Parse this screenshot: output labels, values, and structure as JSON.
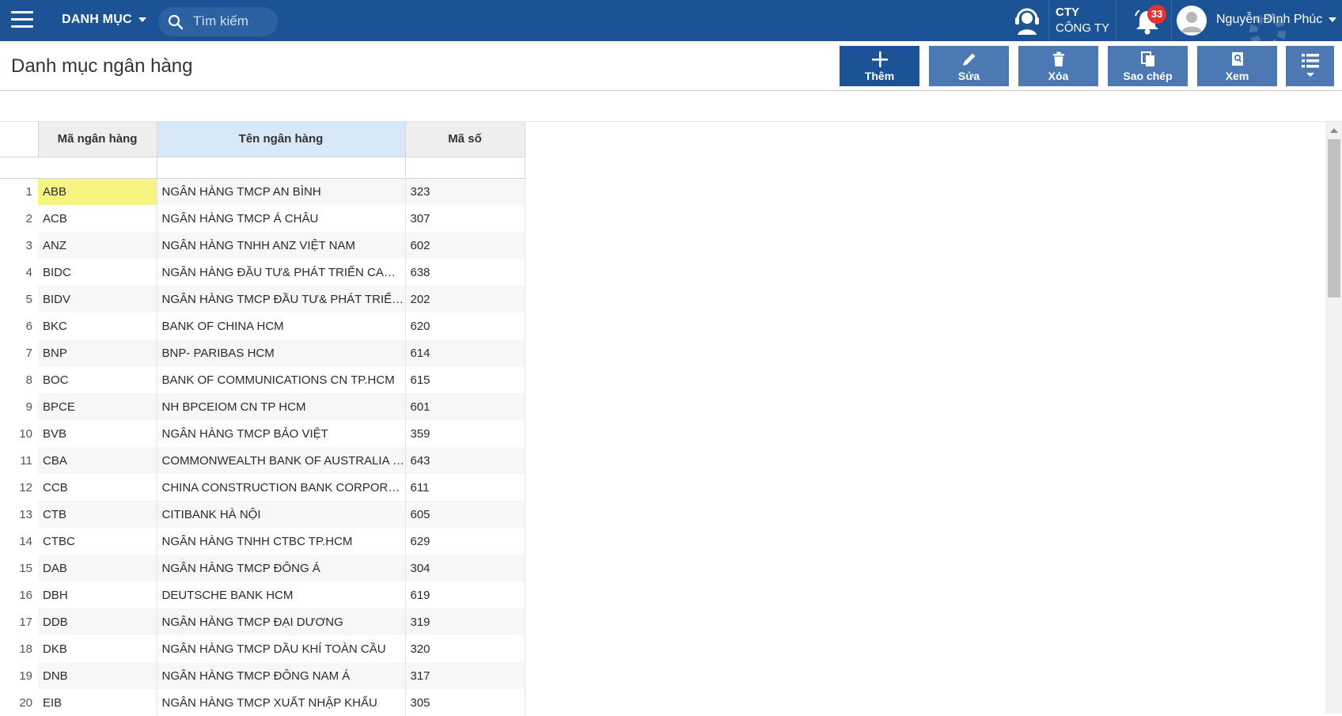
{
  "topbar": {
    "menu_label": "DANH MỤC",
    "search_placeholder": "Tìm kiếm",
    "company_short": "CTY",
    "company_name": "CÔNG TY",
    "notification_count": "33",
    "user_name": "Nguyễn Đình Phúc",
    "bg_color": "#1c5394"
  },
  "page": {
    "title": "Danh mục ngân hàng"
  },
  "toolbar": {
    "add_label": "Thêm",
    "edit_label": "Sửa",
    "delete_label": "Xóa",
    "copy_label": "Sao chép",
    "view_label": "Xem"
  },
  "grid": {
    "columns": [
      "Mã ngân hàng",
      "Tên ngân hàng",
      "Mã số"
    ],
    "rows": [
      {
        "index": "1",
        "code": "ABB",
        "name": "NGÂN HÀNG TMCP AN BÌNH",
        "number": "323"
      },
      {
        "index": "2",
        "code": "ACB",
        "name": "NGÂN HÀNG TMCP Á CHÂU",
        "number": "307"
      },
      {
        "index": "3",
        "code": "ANZ",
        "name": "NGÂN HÀNG TNHH ANZ VIỆT NAM",
        "number": "602"
      },
      {
        "index": "4",
        "code": "BIDC",
        "name": "NGÂN HÀNG ĐẦU TƯ& PHÁT TRIỂN CAMP...",
        "number": "638"
      },
      {
        "index": "5",
        "code": "BIDV",
        "name": "NGÂN HÀNG TMCP ĐẦU TƯ& PHÁT TRIỂN...",
        "number": "202"
      },
      {
        "index": "6",
        "code": "BKC",
        "name": "BANK OF CHINA HCM",
        "number": "620"
      },
      {
        "index": "7",
        "code": "BNP",
        "name": "BNP- PARIBAS HCM",
        "number": "614"
      },
      {
        "index": "8",
        "code": "BOC",
        "name": "BANK OF COMMUNICATIONS CN TP.HCM",
        "number": "615"
      },
      {
        "index": "9",
        "code": "BPCE",
        "name": "NH BPCEIOM CN TP HCM",
        "number": "601"
      },
      {
        "index": "10",
        "code": "BVB",
        "name": "NGÂN HÀNG TMCP BẢO VIỆT",
        "number": "359"
      },
      {
        "index": "11",
        "code": "CBA",
        "name": "COMMONWEALTH BANK OF AUSTRALIA H...",
        "number": "643"
      },
      {
        "index": "12",
        "code": "CCB",
        "name": "CHINA CONSTRUCTION BANK CORPORATI...",
        "number": "611"
      },
      {
        "index": "13",
        "code": "CTB",
        "name": "CITIBANK HÀ NỘI",
        "number": "605"
      },
      {
        "index": "14",
        "code": "CTBC",
        "name": "NGÂN HÀNG TNHH CTBC TP.HCM",
        "number": "629"
      },
      {
        "index": "15",
        "code": "DAB",
        "name": "NGÂN HÀNG TMCP ĐÔNG Á",
        "number": "304"
      },
      {
        "index": "16",
        "code": "DBH",
        "name": "DEUTSCHE BANK HCM",
        "number": "619"
      },
      {
        "index": "17",
        "code": "DDB",
        "name": "NGÂN HÀNG TMCP ĐẠI DƯƠNG",
        "number": "319"
      },
      {
        "index": "18",
        "code": "DKB",
        "name": "NGÂN HÀNG TMCP DẦU KHÍ TOÀN CẦU",
        "number": "320"
      },
      {
        "index": "19",
        "code": "DNB",
        "name": "NGÂN HÀNG TMCP ĐÔNG NAM Á",
        "number": "317"
      },
      {
        "index": "20",
        "code": "EIB",
        "name": "NGÂN HÀNG TMCP XUẤT NHẬP KHẨU",
        "number": "305"
      }
    ],
    "selected_color": "#f6f582",
    "header_highlight_color": "#d9e8f8"
  },
  "icons": {
    "menu": "hamburger-icon",
    "search": "search-icon",
    "support": "headset-icon",
    "notifications": "bell-icon",
    "user": "user-avatar-icon",
    "add": "plus-icon",
    "edit": "pencil-icon",
    "delete": "trash-icon",
    "copy": "copy-icon",
    "view": "view-icon",
    "list": "list-icon"
  }
}
